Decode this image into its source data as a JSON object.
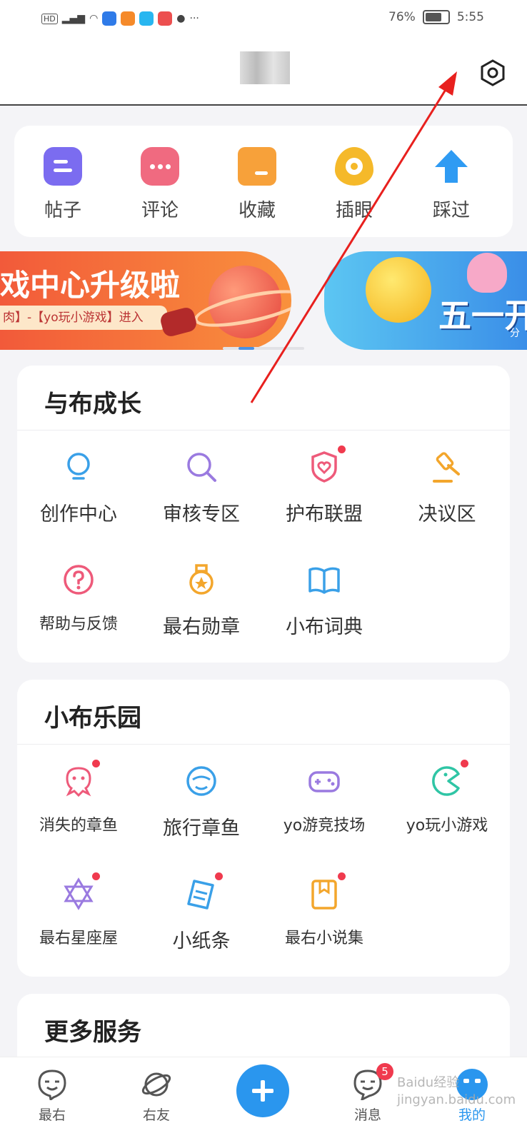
{
  "status_bar": {
    "left_icons": [
      "hd-icon",
      "4g-signal-icon",
      "wifi-icon",
      "app-notification-icons",
      "chat-icon"
    ],
    "more": "···",
    "battery": "76%",
    "time": "5:55"
  },
  "header": {
    "settings_icon": "gear-hexagon-icon"
  },
  "quick_actions": [
    {
      "label": "帖子",
      "icon": "post-icon",
      "color": "#7b6cf0"
    },
    {
      "label": "评论",
      "icon": "comment-icon",
      "color": "#f06a80"
    },
    {
      "label": "收藏",
      "icon": "folder-icon",
      "color": "#f7a13a"
    },
    {
      "label": "插眼",
      "icon": "eye-icon",
      "color": "#f5b92a"
    },
    {
      "label": "踩过",
      "icon": "arrow-up-icon",
      "color": "#2f9bf3"
    }
  ],
  "banners": [
    {
      "title": "戏中心升级啦",
      "subtitle": "肉】-【yo玩小游戏】进入"
    },
    {
      "title": "五一开",
      "subtitle": "分"
    }
  ],
  "growth_section": {
    "title": "与布成长",
    "items": [
      {
        "label": "创作中心",
        "icon": "bulb-icon",
        "color": "#3aa0e8",
        "dot": false
      },
      {
        "label": "审核专区",
        "icon": "magnifier-icon",
        "color": "#9a7ae0",
        "dot": false
      },
      {
        "label": "护布联盟",
        "icon": "shield-heart-icon",
        "color": "#ee5a7a",
        "dot": true
      },
      {
        "label": "决议区",
        "icon": "gavel-icon",
        "color": "#f3a62c",
        "dot": false
      },
      {
        "label": "帮助与反馈",
        "icon": "question-icon",
        "color": "#ee5a7a",
        "dot": false
      },
      {
        "label": "最右勋章",
        "icon": "medal-icon",
        "color": "#f3a62c",
        "dot": false
      },
      {
        "label": "小布词典",
        "icon": "book-icon",
        "color": "#3aa0e8",
        "dot": false
      }
    ]
  },
  "park_section": {
    "title": "小布乐园",
    "items": [
      {
        "label": "消失的章鱼",
        "icon": "octopus-icon",
        "color": "#ee5a7a",
        "dot": true
      },
      {
        "label": "旅行章鱼",
        "icon": "traveler-icon",
        "color": "#3aa0e8",
        "dot": false
      },
      {
        "label": "yo游竞技场",
        "icon": "gamepad-icon",
        "color": "#9a7ae0",
        "dot": false
      },
      {
        "label": "yo玩小游戏",
        "icon": "pacman-icon",
        "color": "#2fc5a5",
        "dot": true
      },
      {
        "label": "最右星座屋",
        "icon": "star-of-david-icon",
        "color": "#9a7ae0",
        "dot": true
      },
      {
        "label": "小纸条",
        "icon": "paper-note-icon",
        "color": "#3aa0e8",
        "dot": true
      },
      {
        "label": "最右小说集",
        "icon": "novel-book-icon",
        "color": "#f3a62c",
        "dot": true
      }
    ]
  },
  "more_section": {
    "title": "更多服务"
  },
  "tabbar": {
    "tabs": [
      {
        "label": "最右",
        "icon": "smile-face-icon"
      },
      {
        "label": "右友",
        "icon": "planet-icon"
      },
      {
        "label": "",
        "icon": "plus-icon"
      },
      {
        "label": "消息",
        "icon": "message-face-icon",
        "badge": "5"
      },
      {
        "label": "我的",
        "icon": "mascot-avatar-icon"
      }
    ]
  },
  "watermark": "Baidu经验 jingyan.baidu.com"
}
